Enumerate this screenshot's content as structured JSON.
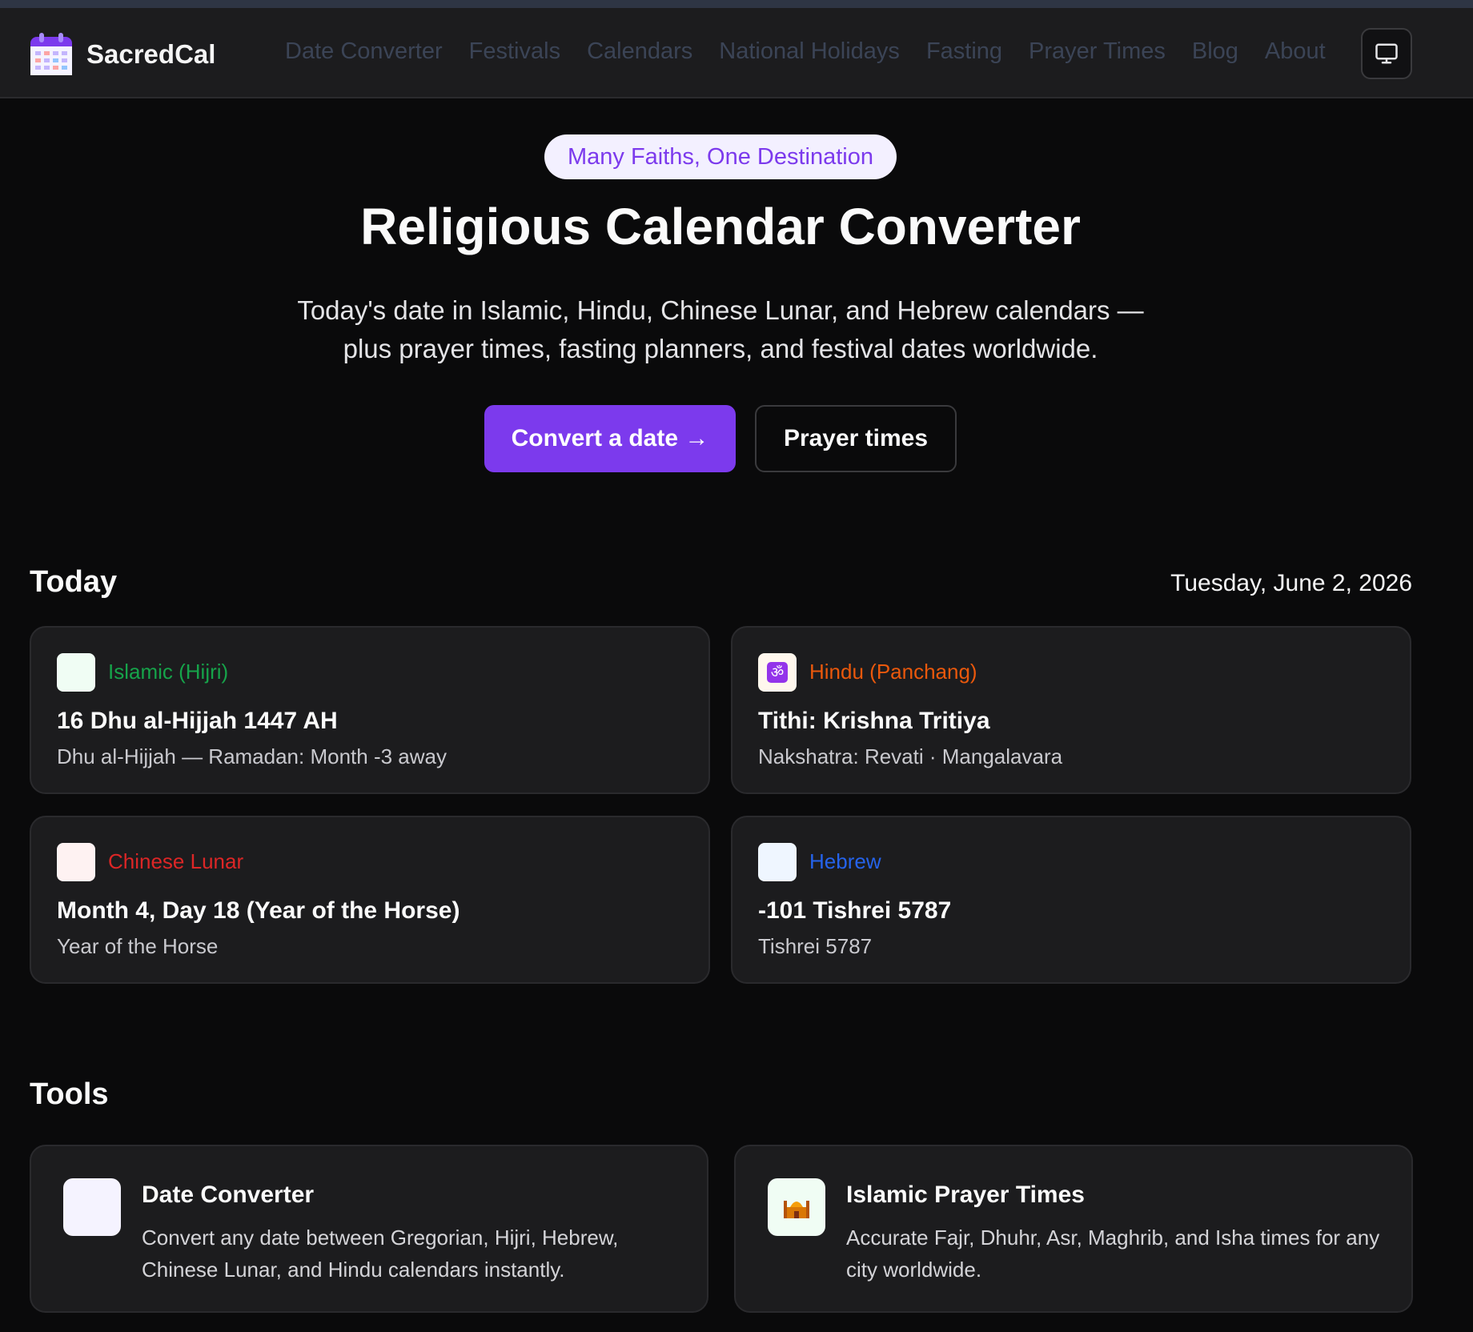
{
  "brand": {
    "name": "SacredCal",
    "logo_icon": "calendar-icon",
    "accent": "#7c3aed"
  },
  "nav": {
    "items": [
      "Date Converter",
      "Festivals",
      "Calendars",
      "National Holidays",
      "Fasting",
      "Prayer Times",
      "Blog",
      "About"
    ],
    "display_toggle_icon": "monitor-icon"
  },
  "hero": {
    "badge": "Many Faiths, One Destination",
    "title": "Religious Calendar Converter",
    "subtitle_line1": "Today's date in Islamic, Hindu, Chinese Lunar, and Hebrew calendars —",
    "subtitle_line2": "plus prayer times, fasting planners, and festival dates worldwide.",
    "primary_cta": "Convert a date →",
    "secondary_cta": "Prayer times"
  },
  "today": {
    "heading": "Today",
    "date": "Tuesday, June 2, 2026",
    "cards": [
      {
        "name": "Islamic (Hijri)",
        "color": "#16a34a",
        "icon_bg": "#f0fdf4",
        "main": "16 Dhu al-Hijjah 1447 AH",
        "sub": "Dhu al-Hijjah — Ramadan: Month -3 away"
      },
      {
        "name": "Hindu (Panchang)",
        "color": "#ea580c",
        "icon_bg": "#fff7ed",
        "icon": "om-icon",
        "icon_glyph": "ॐ",
        "main": "Tithi: Krishna Tritiya",
        "sub": "Nakshatra: Revati · Mangalavara"
      },
      {
        "name": "Chinese Lunar",
        "color": "#dc2626",
        "icon_bg": "#fef2f2",
        "main": "Month 4, Day 18 (Year of the Horse)",
        "sub": "Year of the Horse"
      },
      {
        "name": "Hebrew",
        "color": "#2563eb",
        "icon_bg": "#eff6ff",
        "main": "-101 Tishrei 5787",
        "sub": "Tishrei 5787"
      }
    ]
  },
  "tools": {
    "heading": "Tools",
    "items": [
      {
        "title": "Date Converter",
        "desc": "Convert any date between Gregorian, Hijri, Hebrew, Chinese Lunar, and Hindu calendars instantly.",
        "icon_bg": "#f5f3ff"
      },
      {
        "title": "Islamic Prayer Times",
        "desc": "Accurate Fajr, Dhuhr, Asr, Maghrib, and Isha times for any city worldwide.",
        "icon_bg": "#f0fdf4",
        "icon": "mosque-icon"
      }
    ]
  }
}
